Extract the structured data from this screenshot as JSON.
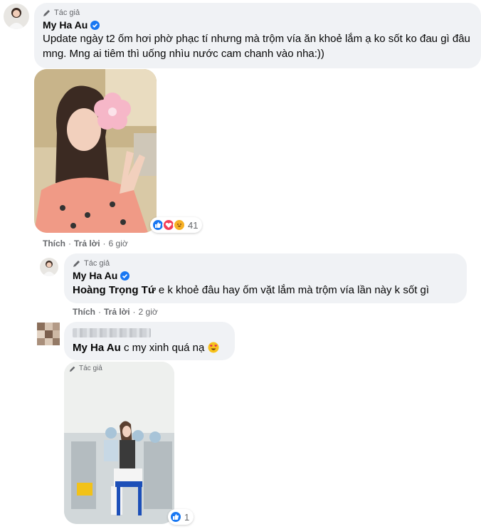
{
  "comment1": {
    "author_badge": "Tác giả",
    "name": "My Ha Au",
    "text": "Update ngày t2 ốm hơi phờ phạc tí nhưng mà trộm vía ăn khoẻ lắm ạ ko sốt ko đau gì đâu mng. Mng ai tiêm thì uống nhìu nước cam chanh vào nha:))",
    "reaction_count": "41",
    "reaction_icons": [
      "like-icon",
      "love-icon",
      "haha-icon"
    ],
    "like_label": "Thích",
    "reply_label": "Trả lời",
    "time": "6 giờ"
  },
  "reply1": {
    "author_badge": "Tác giả",
    "name": "My Ha Au",
    "mention": "Hoàng Trọng Tứ",
    "text": "e k khoẻ đâu hay ốm vặt lắm mà trộm vía lần này k sốt gì",
    "like_label": "Thích",
    "reply_label": "Trả lời",
    "time": "2 giờ"
  },
  "reply2": {
    "mention": "My Ha Au",
    "text": "c my xinh quá nạ",
    "emoji": "heart-eyes-emoji",
    "photo_badge": "Tác giả",
    "reaction_count": "1",
    "reaction_icons": [
      "like-icon"
    ]
  },
  "colors": {
    "bubble_bg": "#f0f2f5",
    "verified_blue": "#1877f2",
    "meta_gray": "#65676b",
    "love_red": "#f33e58",
    "haha_yellow": "#f7b125"
  }
}
